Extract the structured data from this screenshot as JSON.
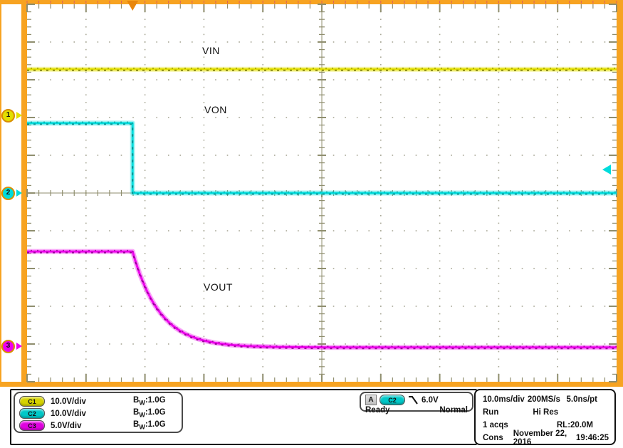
{
  "colors": {
    "accent_border": "#F7A321",
    "trigger_marker": "#E8860B",
    "graticule": "#8F8E6E",
    "grid_dots": "#A8A796",
    "top_tick_red": "#E06060",
    "c1": "#E3DF00",
    "c1_noise": "#7A7A00",
    "c1_pill": "#D6D300",
    "c2": "#00DCDC",
    "c2_noise": "#008C8C",
    "c2_pill": "#00C8C8",
    "c3": "#EE00EE",
    "c3_noise": "#8E008E",
    "c3_pill": "#E000E0"
  },
  "annotations": {
    "vin": "VIN",
    "von": "VON",
    "vout": "VOUT"
  },
  "markers": {
    "ch1": "1",
    "ch2": "2",
    "ch3": "3"
  },
  "chart_data": {
    "type": "line",
    "title": "Oscilloscope capture: VIN, VON, VOUT during turn-off",
    "x_axis": {
      "scale": "10.0ms/div",
      "divisions": 10,
      "span": "100 ms"
    },
    "y_axis": {
      "divisions": 10
    },
    "grid": "dotted graticule with center crosshair ticks",
    "trigger": {
      "source": "C2",
      "slope": "falling",
      "level": "6.0V",
      "position_div": 1.79,
      "level_marker_y_div": 4.38
    },
    "series": [
      {
        "name": "VIN",
        "channel": "C1",
        "scale": "10.0V/div",
        "color": "#E3DF00",
        "noise_color": "#7A7A00",
        "ref_marker_y_div": 2.94,
        "description": "constant ~12 V across full 100 ms window",
        "points_div": [
          [
            0,
            1.72
          ],
          [
            10,
            1.72
          ]
        ]
      },
      {
        "name": "VON",
        "channel": "C2",
        "scale": "10.0V/div",
        "color": "#00DCDC",
        "noise_color": "#008C8C",
        "ref_marker_y_div": 5.0,
        "description": "~18 V high, steps to 0 V at trigger (falling edge through 6.0 V)",
        "points_div": [
          [
            0,
            3.15
          ],
          [
            1.79,
            3.15
          ],
          [
            1.79,
            5.0
          ],
          [
            10,
            5.0
          ]
        ]
      },
      {
        "name": "VOUT",
        "channel": "C3",
        "scale": "5.0V/div",
        "color": "#EE00EE",
        "noise_color": "#8E008E",
        "ref_marker_y_div": 9.06,
        "description": "~12.5 V flat, exponential decay to 0 V after trigger",
        "decay": {
          "start_x_div": 1.79,
          "flat_y_div": 6.55,
          "settle_y_div": 9.09,
          "tau_div": 0.46
        }
      }
    ]
  },
  "status_bar": {
    "channels": [
      {
        "badge": "C1",
        "scale": "10.0V/div",
        "bw_b": "B",
        "bw_sub": "W",
        "bw_rest": ":1.0G"
      },
      {
        "badge": "C2",
        "scale": "10.0V/div",
        "bw_b": "B",
        "bw_sub": "W",
        "bw_rest": ":1.0G"
      },
      {
        "badge": "C3",
        "scale": "5.0V/div",
        "bw_b": "B",
        "bw_sub": "W",
        "bw_rest": ":1.0G"
      }
    ],
    "trigger": {
      "system": "A",
      "source": "C2",
      "level": "6.0V",
      "status": "Ready",
      "mode": "Normal"
    },
    "acquisition": {
      "timebase": "10.0ms/div",
      "sample_rate": "200MS/s",
      "resolution": "5.0ns/pt",
      "run_state": "Run",
      "acq_mode": "Hi Res",
      "acq_count": "1 acqs",
      "record_length": "RL:20.0M",
      "label": "Cons",
      "date": "November 22, 2016",
      "time": "19:46:25"
    }
  }
}
